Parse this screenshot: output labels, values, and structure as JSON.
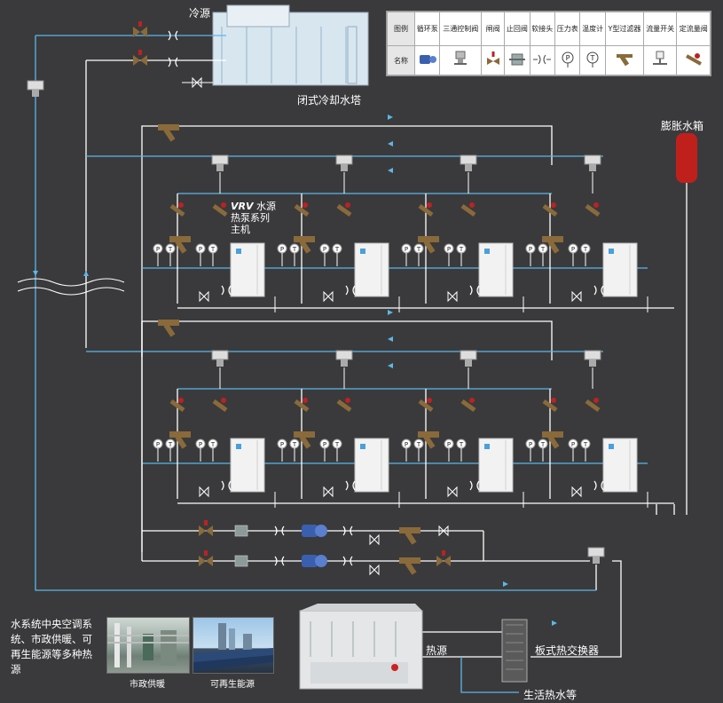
{
  "labels": {
    "cold_source": "冷源",
    "closed_tower": "闭式冷却水塔",
    "expansion_tank": "膨胀水箱",
    "vrv_brand": "VRV",
    "vrv_line1": "水源",
    "vrv_line2": "热泵系列",
    "vrv_line3": "主机",
    "heat_source": "热源",
    "plate_exchanger": "板式热交换器",
    "domestic_hot_water": "生活热水等"
  },
  "legend": {
    "row1_header": "图例",
    "row2_header": "名称",
    "items": [
      {
        "name": "循环泵",
        "icon": "pump-icon"
      },
      {
        "name": "三通控制阀",
        "icon": "three-way-valve-icon"
      },
      {
        "name": "闸阀",
        "icon": "gate-valve-icon"
      },
      {
        "name": "止回阀",
        "icon": "check-valve-icon"
      },
      {
        "name": "软接头",
        "icon": "flexible-joint-icon"
      },
      {
        "name": "压力表",
        "icon": "pressure-gauge-icon"
      },
      {
        "name": "温度计",
        "icon": "thermometer-icon"
      },
      {
        "name": "Y型过滤器",
        "icon": "y-strainer-icon"
      },
      {
        "name": "流量开关",
        "icon": "flow-switch-icon"
      },
      {
        "name": "定流量阀",
        "icon": "constant-flow-valve-icon"
      }
    ]
  },
  "gauge_marks": {
    "pressure": "P",
    "temperature": "T"
  },
  "note": "水系统中央空调系统、市政供暖、可再生能源等多种热源",
  "photos": [
    {
      "caption": "市政供暖"
    },
    {
      "caption": "可再生能源"
    }
  ],
  "colors": {
    "background": "#3a3a3c",
    "supply_pipe": "#5bb8e8",
    "return_pipe": "#ffffff",
    "arrow": "#5bb8e8",
    "tank": "#c0201b",
    "pump": "#3a5fae",
    "valve_body": "#8a6a3a"
  }
}
